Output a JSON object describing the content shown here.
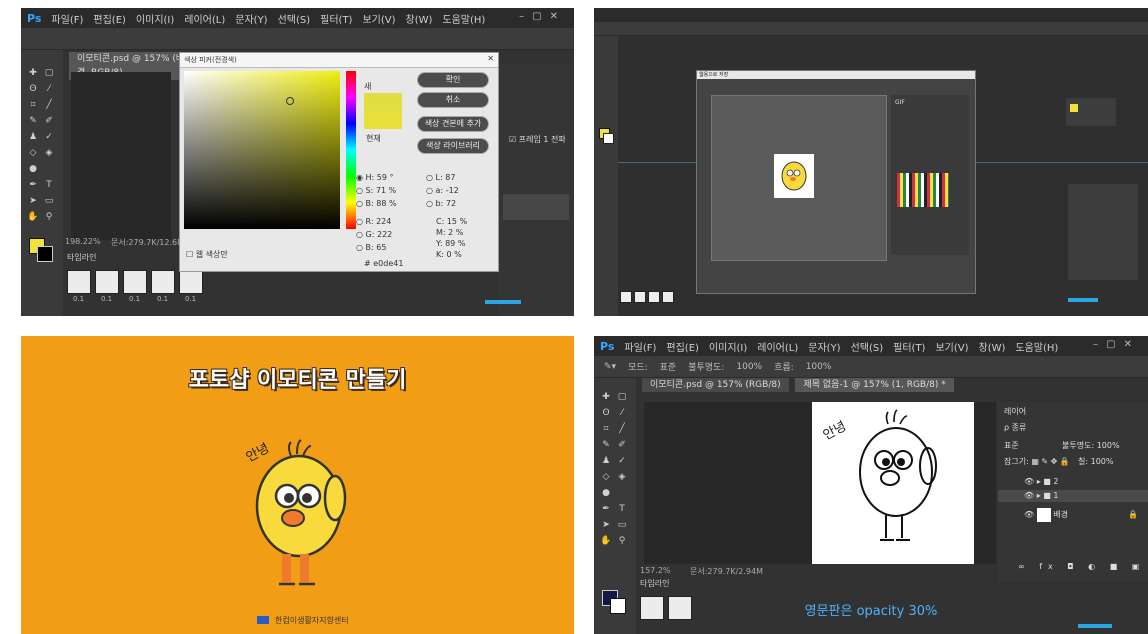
{
  "tl": {
    "menu": [
      "Ps",
      "파일(F)",
      "편집(E)",
      "이미지(I)",
      "레이어(L)",
      "문자(Y)",
      "선택(S)",
      "필터(T)",
      "보기(V)",
      "창(W)",
      "도움말(H)"
    ],
    "doc_tab": "이모티콘.psd @ 157% (배경, RGB/8)",
    "dialog_title": "색상 피커(전경색)",
    "buttons": [
      "확인",
      "취소",
      "색상 견본에 추가",
      "색상 라이브러리"
    ],
    "new_label": "새",
    "current_label": "현재",
    "web_only": "웹 색상만",
    "hsb": [
      {
        "k": "H:",
        "v": "59",
        "u": "°"
      },
      {
        "k": "S:",
        "v": "71",
        "u": "%"
      },
      {
        "k": "B:",
        "v": "88",
        "u": "%"
      }
    ],
    "rgb": [
      {
        "k": "R:",
        "v": "224"
      },
      {
        "k": "G:",
        "v": "222"
      },
      {
        "k": "B:",
        "v": "65"
      }
    ],
    "lab": [
      {
        "k": "L:",
        "v": "87"
      },
      {
        "k": "a:",
        "v": "-12"
      },
      {
        "k": "b:",
        "v": "72"
      }
    ],
    "cmyk": [
      {
        "k": "C:",
        "v": "15",
        "u": "%"
      },
      {
        "k": "M:",
        "v": "2",
        "u": "%"
      },
      {
        "k": "Y:",
        "v": "89",
        "u": "%"
      },
      {
        "k": "K:",
        "v": "0",
        "u": "%"
      }
    ],
    "hex": "e0de41",
    "zoom": "198.22%",
    "doc_info": "문서:279.7K/12.6M",
    "timeline": "타임라인",
    "frame_delay": "0.1",
    "right_panel_items": [
      "프레임 1 전파"
    ],
    "fg_color": "#f4e13c"
  },
  "tr": {
    "dialog_title": "웹용으로 저장",
    "status": "GIF"
  },
  "bl": {
    "title": "포토샵 이모티콘 만들기",
    "speech": "안녕",
    "footer": "한컴이생활자지향센터",
    "bg_color": "#f19d16",
    "body_color": "#f9da3c",
    "beak_color": "#f07a2b"
  },
  "br": {
    "menu": [
      "Ps",
      "파일(F)",
      "편집(E)",
      "이미지(I)",
      "레이어(L)",
      "문자(Y)",
      "선택(S)",
      "필터(T)",
      "보기(V)",
      "창(W)",
      "도움말(H)"
    ],
    "options": [
      "모드:",
      "표준",
      "불투명도:",
      "100%",
      "흐름:",
      "100%"
    ],
    "tabs": [
      "이모티콘.psd @ 157% (RGB/8)",
      "제목 없음-1 @ 157% (1, RGB/8) *"
    ],
    "speech": "안녕",
    "layers_title": "레이어",
    "layer_kind": "종류",
    "blend_mode": "표준",
    "opacity_label": "불투명도:",
    "opacity_value": "100%",
    "lock_label": "잠그기:",
    "fill_label": "칠:",
    "fill_value": "100%",
    "layers": [
      "2",
      "1",
      "배경"
    ],
    "zoom": "157.2%",
    "doc_info": "문서:279.7K/2.94M",
    "timeline": "타임라인",
    "caption": "영문판은 opacity 30%"
  }
}
